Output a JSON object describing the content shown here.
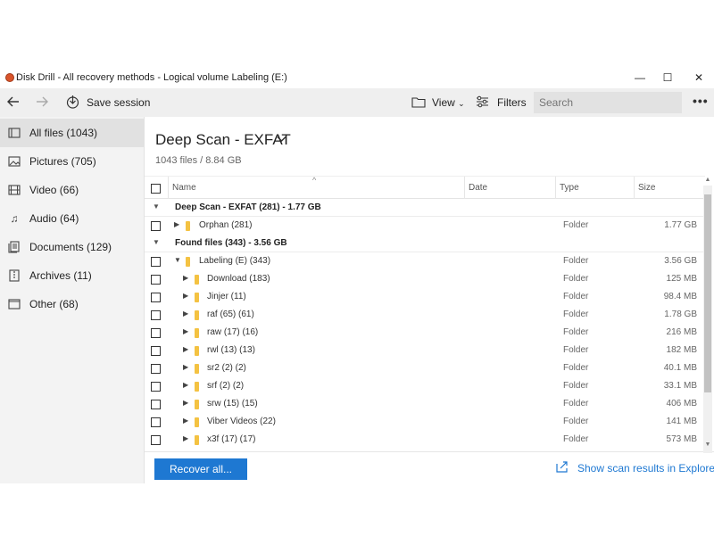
{
  "window": {
    "title": "Disk Drill - All recovery methods - Logical volume Labeling (E:)",
    "minimize": "—",
    "maximize": "☐",
    "close": "✕"
  },
  "toolbar": {
    "back_icon": "arrow-left-icon",
    "forward_icon": "arrow-right-icon",
    "save_session_label": "Save session",
    "view_label": "View",
    "filters_label": "Filters",
    "search_placeholder": "Search",
    "more_label": "•••"
  },
  "sidebar": {
    "items": [
      {
        "label": "All files (1043)",
        "icon": "all-files-icon",
        "active": true
      },
      {
        "label": "Pictures (705)",
        "icon": "pictures-icon"
      },
      {
        "label": "Video (66)",
        "icon": "video-icon"
      },
      {
        "label": "Audio (64)",
        "icon": "audio-icon"
      },
      {
        "label": "Documents (129)",
        "icon": "documents-icon"
      },
      {
        "label": "Archives (11)",
        "icon": "archives-icon"
      },
      {
        "label": "Other (68)",
        "icon": "other-icon"
      }
    ]
  },
  "main": {
    "title": "Deep Scan - EXFAT",
    "summary": "1043 files / 8.84 GB",
    "columns": {
      "name": "Name",
      "date": "Date",
      "type": "Type",
      "size": "Size"
    },
    "groups": [
      {
        "label": "Deep Scan - EXFAT (281) - 1.77 GB"
      },
      {
        "label": "Found files (343) - 3.56 GB"
      }
    ],
    "rows": [
      {
        "name": "Orphan (281)",
        "type": "Folder",
        "size": "1.77 GB"
      },
      {
        "name": "Labeling (E) (343)",
        "type": "Folder",
        "size": "3.56 GB"
      },
      {
        "name": "Download (183)",
        "type": "Folder",
        "size": "125 MB"
      },
      {
        "name": "Jinjer (11)",
        "type": "Folder",
        "size": "98.4 MB"
      },
      {
        "name": "raf (65) (61)",
        "type": "Folder",
        "size": "1.78 GB"
      },
      {
        "name": "raw (17) (16)",
        "type": "Folder",
        "size": "216 MB"
      },
      {
        "name": "rwl (13) (13)",
        "type": "Folder",
        "size": "182 MB"
      },
      {
        "name": "sr2 (2) (2)",
        "type": "Folder",
        "size": "40.1 MB"
      },
      {
        "name": "srf (2) (2)",
        "type": "Folder",
        "size": "33.1 MB"
      },
      {
        "name": "srw (15) (15)",
        "type": "Folder",
        "size": "406 MB"
      },
      {
        "name": "Viber Videos (22)",
        "type": "Folder",
        "size": "141 MB"
      },
      {
        "name": "x3f (17) (17)",
        "type": "Folder",
        "size": "573 MB"
      }
    ]
  },
  "footer": {
    "recover_label": "Recover all...",
    "explorer_label": "Show scan results in Explorer"
  },
  "colors": {
    "accent": "#1e78d2",
    "folder": "#f4c242",
    "sidebar_bg": "#f3f3f3",
    "toolbar_bg": "#efefef"
  }
}
